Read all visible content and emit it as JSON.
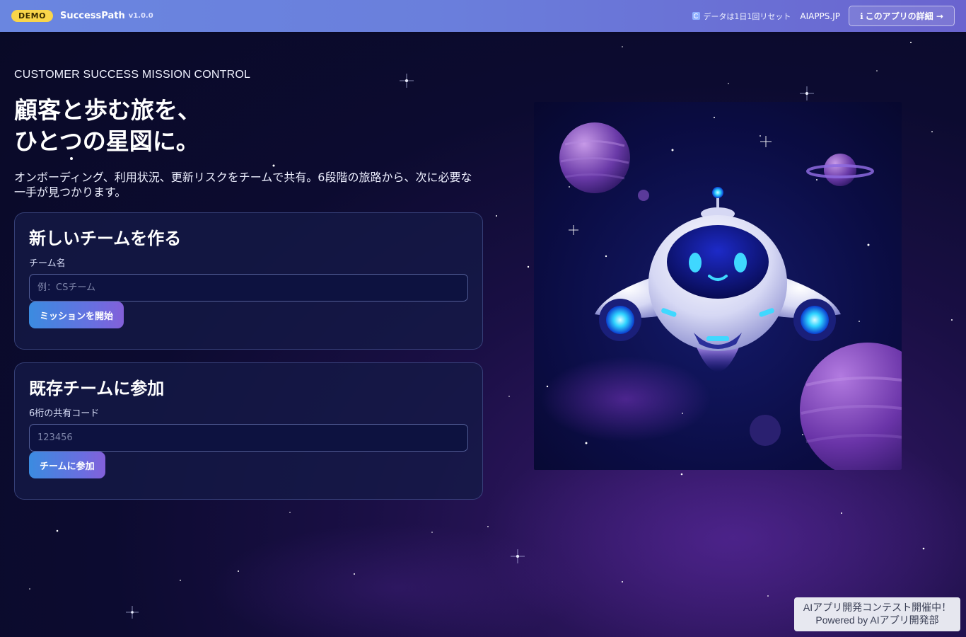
{
  "topbar": {
    "badge": "DEMO",
    "app_name": "SuccessPath",
    "version": "v1.0.0",
    "reset_note": "データは1日1回リセット",
    "site_link": "AIAPPS.JP",
    "about_button": "このアプリの詳細 →"
  },
  "hero": {
    "eyebrow": "CUSTOMER SUCCESS MISSION CONTROL",
    "headline_line1": "顧客と歩む旅を、",
    "headline_line2": "ひとつの星図に。",
    "lead": "オンボーディング、利用状況、更新リスクをチームで共有。6段階の旅路から、次に必要な一手が見つかります。"
  },
  "create_team": {
    "title": "新しいチームを作る",
    "label": "チーム名",
    "placeholder": "例：CSチーム",
    "value": "",
    "button": "ミッションを開始"
  },
  "join_team": {
    "title": "既存チームに参加",
    "label": "6桁の共有コード",
    "placeholder": "123456",
    "value": "",
    "button": "チームに参加"
  },
  "promo": {
    "line1": "AIアプリ開発コンテスト開催中！",
    "line2": "Powered by AIアプリ開発部"
  },
  "icons": {
    "reset": "refresh-icon",
    "about": "info-icon",
    "illustration": "robot-spaceship-illustration"
  },
  "colors": {
    "badge": "#f9d54a",
    "topbar_start": "#6a86e0",
    "topbar_end": "#6a64cf",
    "button_start": "#3b8be0",
    "button_end": "#8360d9",
    "background": "#0c0b30"
  }
}
